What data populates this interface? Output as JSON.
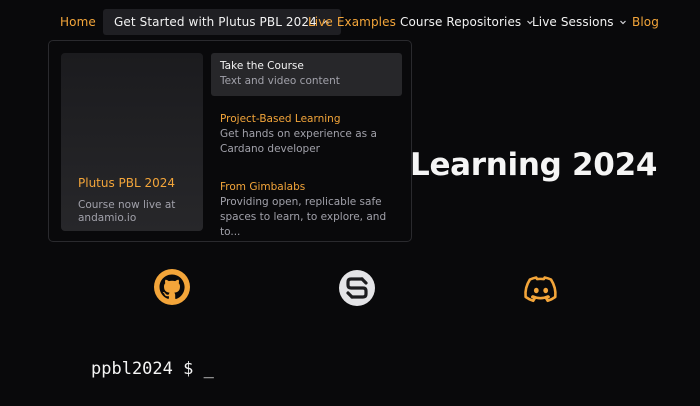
{
  "nav": {
    "home": "Home",
    "get_started": "Get Started with Plutus PBL 2024",
    "live_examples": "Live Examples",
    "course_repos": "Course Repositories",
    "live_sessions": "Live Sessions",
    "blog": "Blog"
  },
  "hero": {
    "title_visible": "Learning 2024"
  },
  "dropdown": {
    "feature": {
      "title": "Plutus PBL 2024",
      "description": "Course now live at andamio.io"
    },
    "items": [
      {
        "title": "Take the Course",
        "description": "Text and video content"
      },
      {
        "title": "Project-Based Learning",
        "description": "Get hands on experience as a Cardano developer"
      },
      {
        "title": "From Gimbalabs",
        "description": "Providing open, replicable safe spaces to learn, to explore, and to..."
      }
    ]
  },
  "icons": {
    "github": "github-icon",
    "gimbalabs": "gimbalabs-logo-icon",
    "discord": "discord-icon"
  },
  "terminal": {
    "prompt": "ppbl2024 $ _"
  },
  "colors": {
    "accent": "#f3a53a",
    "background": "#09090b",
    "menu_highlight": "#27272a"
  }
}
